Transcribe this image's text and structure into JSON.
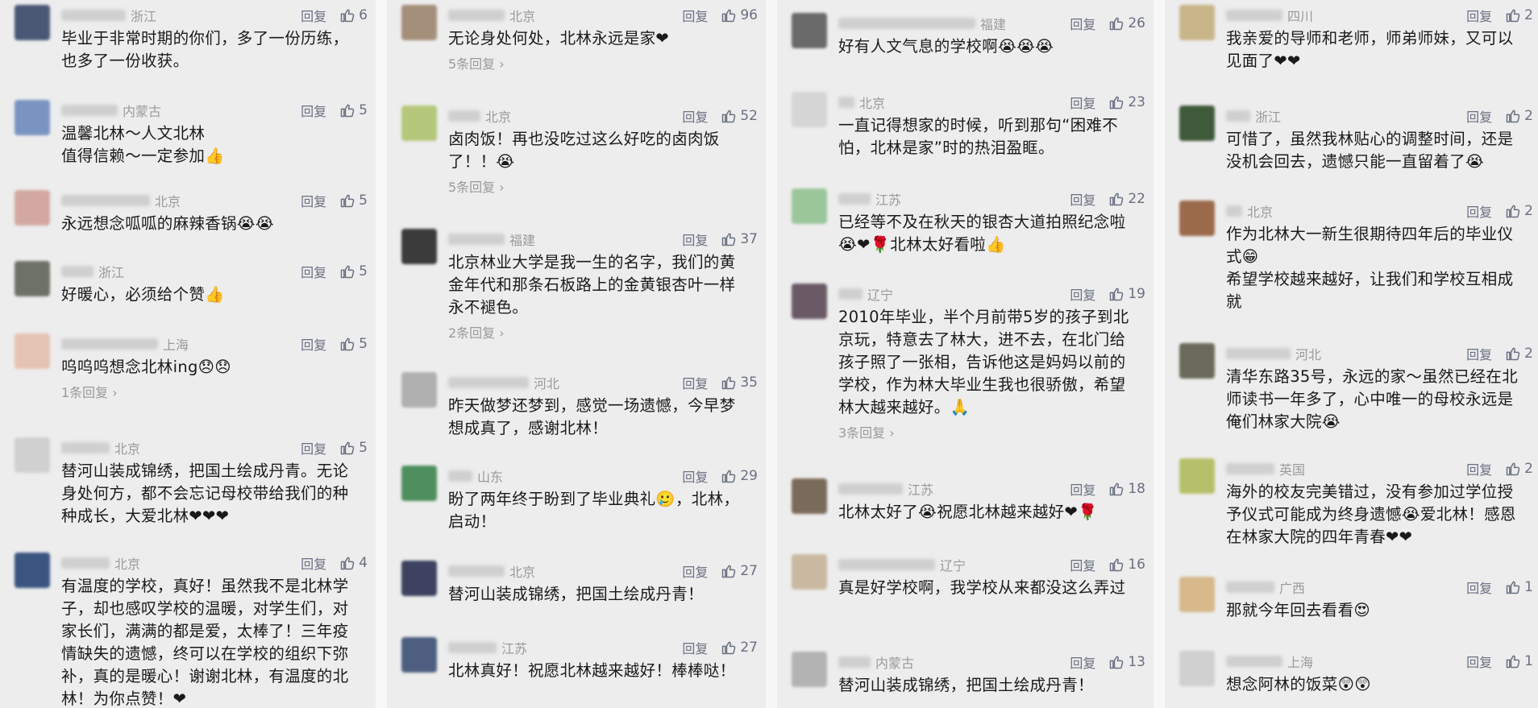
{
  "reply_label": "回复",
  "columns": [
    [
      {
        "loc": "浙江",
        "likes": "6",
        "text": "毕业于非常时期的你们，多了一份历练，也多了一份收获。",
        "more": ""
      },
      {
        "loc": "内蒙古",
        "likes": "5",
        "text": "温馨北林～人文北林\n值得信赖～一定参加👍",
        "more": ""
      },
      {
        "loc": "北京",
        "likes": "5",
        "text": "永远想念呱呱的麻辣香锅😭😭",
        "more": ""
      },
      {
        "loc": "浙江",
        "likes": "5",
        "text": "好暖心，必须给个赞👍",
        "more": ""
      },
      {
        "loc": "上海",
        "likes": "5",
        "text": "呜呜呜想念北林ing😞😞",
        "more": "1条回复 ›"
      },
      {
        "loc": "北京",
        "likes": "5",
        "text": "替河山装成锦绣，把国土绘成丹青。无论身处何方，都不会忘记母校带给我们的种种成长，大爱北林❤❤❤",
        "more": ""
      },
      {
        "loc": "北京",
        "likes": "4",
        "text": "有温度的学校，真好！虽然我不是北林学子，却也感叹学校的温暖，对学生们，对家长们，满满的都是爱，太棒了！三年疫情缺失的遗憾，终可以在学校的组织下弥补，真的是暖心！谢谢北林，有温度的北林！为你点赞！❤",
        "more": ""
      }
    ],
    [
      {
        "loc": "北京",
        "likes": "96",
        "text": "无论身处何处，北林永远是家❤",
        "more": "5条回复 ›"
      },
      {
        "loc": "北京",
        "likes": "52",
        "text": "卤肉饭！再也没吃过这么好吃的卤肉饭了！！😭",
        "more": "5条回复 ›"
      },
      {
        "loc": "福建",
        "likes": "37",
        "text": "北京林业大学是我一生的名字，我们的黄金年代和那条石板路上的金黄银杏叶一样永不褪色。",
        "more": "2条回复 ›"
      },
      {
        "loc": "河北",
        "likes": "35",
        "text": "昨天做梦还梦到，感觉一场遗憾，今早梦想成真了，感谢北林！",
        "more": ""
      },
      {
        "loc": "山东",
        "likes": "29",
        "text": "盼了两年终于盼到了毕业典礼🥲，北林，启动！",
        "more": ""
      },
      {
        "loc": "北京",
        "likes": "27",
        "text": "替河山装成锦绣，把国土绘成丹青！",
        "more": ""
      },
      {
        "loc": "江苏",
        "likes": "27",
        "text": "北林真好！祝愿北林越来越好！棒棒哒！",
        "more": ""
      }
    ],
    [
      {
        "loc": "福建",
        "likes": "26",
        "text": "好有人文气息的学校啊😭😭😭",
        "more": ""
      },
      {
        "loc": "北京",
        "likes": "23",
        "text": "一直记得想家的时候，听到那句“困难不怕，北林是家”时的热泪盈眶。",
        "more": ""
      },
      {
        "loc": "江苏",
        "likes": "22",
        "text": "已经等不及在秋天的银杏大道拍照纪念啦😭❤🌹北林太好看啦👍",
        "more": ""
      },
      {
        "loc": "辽宁",
        "likes": "19",
        "text": "2010年毕业，半个月前带5岁的孩子到北京玩，特意去了林大，进不去，在北门给孩子照了一张相，告诉他这是妈妈以前的学校，作为林大毕业生我也很骄傲，希望林大越来越好。🙏",
        "more": "3条回复 ›"
      },
      {
        "loc": "江苏",
        "likes": "18",
        "text": "北林太好了😭祝愿北林越来越好❤🌹",
        "more": ""
      },
      {
        "loc": "辽宁",
        "likes": "16",
        "text": "真是好学校啊，我学校从来都没这么弄过",
        "more": ""
      },
      {
        "loc": "内蒙古",
        "likes": "13",
        "text": "替河山装成锦绣，把国土绘成丹青！",
        "more": ""
      }
    ],
    [
      {
        "loc": "四川",
        "likes": "2",
        "text": "我亲爱的导师和老师，师弟师妹，又可以见面了❤❤",
        "more": ""
      },
      {
        "loc": "浙江",
        "likes": "2",
        "text": "可惜了，虽然我林贴心的调整时间，还是没机会回去，遗憾只能一直留着了😭",
        "more": ""
      },
      {
        "loc": "北京",
        "likes": "2",
        "text": "作为北林大一新生很期待四年后的毕业仪式😁\n希望学校越来越好，让我们和学校互相成就",
        "more": ""
      },
      {
        "loc": "河北",
        "likes": "2",
        "text": "清华东路35号，永远的家～虽然已经在北师读书一年多了，心中唯一的母校永远是俺们林家大院😭",
        "more": ""
      },
      {
        "loc": "英国",
        "likes": "2",
        "text": "海外的校友完美错过，没有参加过学位授予仪式可能成为终身遗憾😭爱北林！感恩在林家大院的四年青春❤❤",
        "more": ""
      },
      {
        "loc": "广西",
        "likes": "1",
        "text": "那就今年回去看看😍",
        "more": ""
      },
      {
        "loc": "上海",
        "likes": "1",
        "text": "想念阿林的饭菜😲😲",
        "more": ""
      }
    ]
  ]
}
